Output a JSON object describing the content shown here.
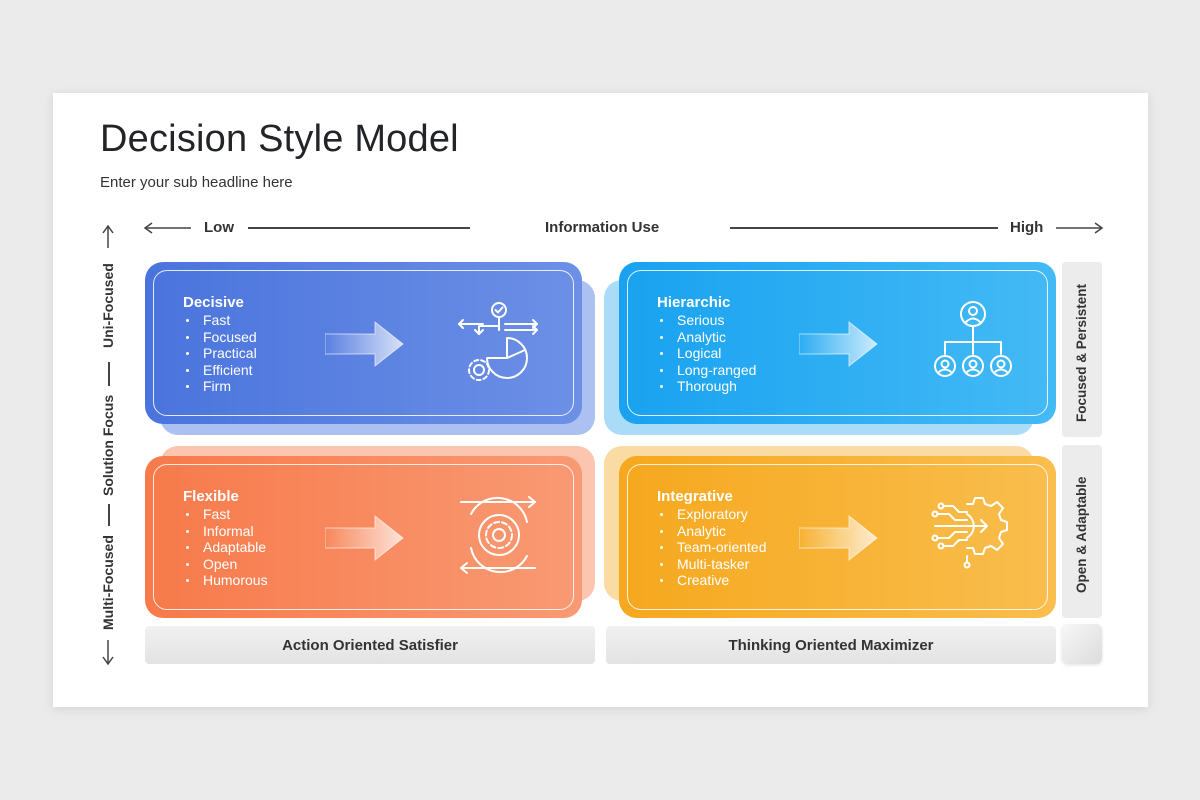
{
  "slide": {
    "title": "Decision Style Model",
    "subtitle": "Enter your sub headline here"
  },
  "top_axis": {
    "low": "Low",
    "label": "Information Use",
    "high": "High"
  },
  "left_axis": {
    "top_label": "Uni-Focused",
    "middle_label": "Solution Focus",
    "bottom_label": "Multi-Focused"
  },
  "quadrants": {
    "decisive": {
      "title": "Decisive",
      "items": [
        "Fast",
        "Focused",
        "Practical",
        "Efficient",
        "Firm"
      ],
      "icon": "decision-gear-chart-icon",
      "color": "#4f79e0"
    },
    "hierarchic": {
      "title": "Hierarchic",
      "items": [
        "Serious",
        "Analytic",
        "Logical",
        "Long-ranged",
        "Thorough"
      ],
      "icon": "org-hierarchy-icon",
      "color": "#22a9f2"
    },
    "flexible": {
      "title": "Flexible",
      "items": [
        "Fast",
        "Informal",
        "Adaptable",
        "Open",
        "Humorous"
      ],
      "icon": "gear-cycle-arrows-icon",
      "color": "#f7804f"
    },
    "integrative": {
      "title": "Integrative",
      "items": [
        "Exploratory",
        "Analytic",
        "Team-oriented",
        "Multi-tasker",
        "Creative"
      ],
      "icon": "circuit-gear-icon",
      "color": "#f7ad25"
    }
  },
  "right_labels": {
    "top": "Focused & Persistent",
    "bottom": "Open & Adaptable"
  },
  "bottom_labels": {
    "left": "Action Oriented Satisfier",
    "right": "Thinking Oriented Maximizer"
  }
}
